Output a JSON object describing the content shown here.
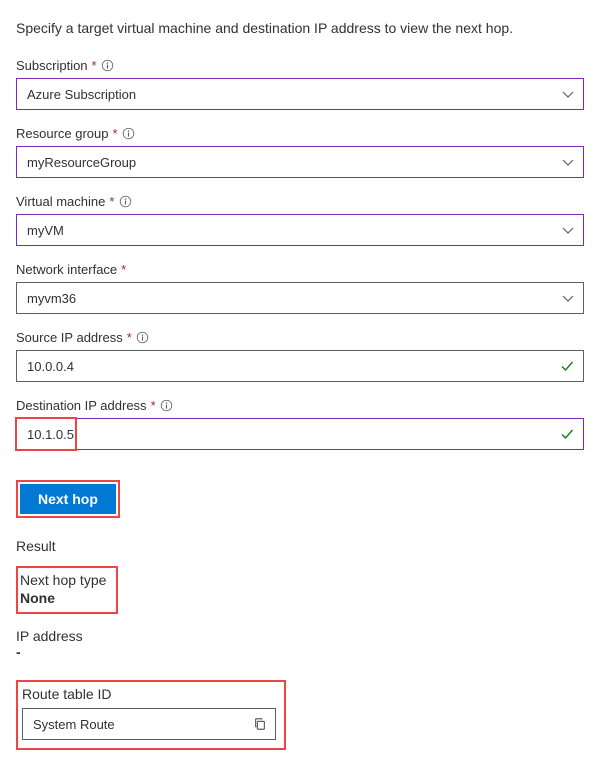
{
  "description": "Specify a target virtual machine and destination IP address to view the next hop.",
  "fields": {
    "subscription": {
      "label": "Subscription",
      "value": "Azure Subscription"
    },
    "resourceGroup": {
      "label": "Resource group",
      "value": "myResourceGroup"
    },
    "virtualMachine": {
      "label": "Virtual machine",
      "value": "myVM"
    },
    "networkInterface": {
      "label": "Network interface",
      "value": "myvm36"
    },
    "sourceIp": {
      "label": "Source IP address",
      "value": "10.0.0.4"
    },
    "destinationIp": {
      "label": "Destination IP address",
      "value": "10.1.0.5"
    }
  },
  "button": {
    "nextHop": "Next hop"
  },
  "result": {
    "heading": "Result",
    "nextHopTypeLabel": "Next hop type",
    "nextHopTypeValue": "None",
    "ipAddressLabel": "IP address",
    "ipAddressValue": "-",
    "routeTableLabel": "Route table ID",
    "routeTableValue": "System Route"
  },
  "required": "*"
}
